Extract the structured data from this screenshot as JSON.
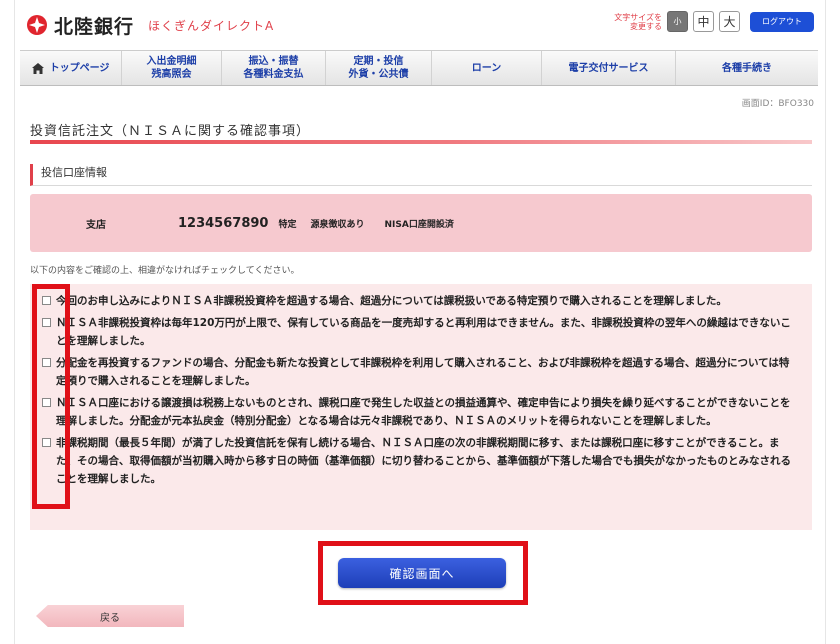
{
  "header": {
    "bank_name": "北陸銀行",
    "service_name": "ほくぎんダイレクトA",
    "fontsize_label": "文字サイズを変更する",
    "fontsize_small": "小",
    "fontsize_medium": "中",
    "fontsize_large": "大",
    "logout_label": "ログアウト"
  },
  "nav": {
    "items": [
      {
        "label": "トップページ"
      },
      {
        "label": "入出金明細\n残高照会"
      },
      {
        "label": "振込・振替\n各種料金支払"
      },
      {
        "label": "定期・投信\n外貨・公共債"
      },
      {
        "label": "ローン"
      },
      {
        "label": "電子交付サービス"
      },
      {
        "label": "各種手続き"
      }
    ]
  },
  "screen_id": "画面ID：BFO330",
  "page_title": "投資信託注文（ＮＩＳＡに関する確認事項）",
  "section_header": "投信口座情報",
  "account": {
    "branch": "支店",
    "number": "1234567890",
    "type": "特定",
    "tax": "源泉徴収あり",
    "nisa": "NISA口座開設済"
  },
  "instruction": "以下の内容をご確認の上、相違がなければチェックしてください。",
  "confirm_items": [
    {
      "text": "今回のお申し込みによりＮＩＳＡ非課税投資枠を超過する場合、超過分については課税扱いである特定預りで購入されることを理解しました。"
    },
    {
      "text": "ＮＩＳＡ非課税投資枠は毎年120万円が上限で、保有している商品を一度売却すると再利用はできません。また、非課税投資枠の翌年への繰越はできないことを理解しました。"
    },
    {
      "text": "分配金を再投資するファンドの場合、分配金も新たな投資として非課税枠を利用して購入されること、および非課税枠を超過する場合、超過分については特定預りで購入されることを理解しました。"
    },
    {
      "text": "ＮＩＳＡ口座における譲渡損は税務上ないものとされ、課税口座で発生した収益との損益通算や、確定申告により損失を繰り延べすることができないことを理解しました。分配金が元本払戻金（特別分配金）となる場合は元々非課税であり、ＮＩＳＡのメリットを得られないことを理解しました。"
    },
    {
      "text": "非課税期間（最長５年間）が満了した投資信託を保有し続ける場合、ＮＩＳＡ口座の次の非課税期間に移す、または課税口座に移すことができること。また、その場合、取得価額が当初購入時から移す日の時価（基準価額）に切り替わることから、基準価額が下落した場合でも損失がなかったものとみなされることを理解しました。"
    }
  ],
  "submit_label": "確認画面へ",
  "back_label": "戻る",
  "colors": {
    "brand_red": "#e0404a",
    "nav_blue": "#1d3fa8",
    "button_blue": "#1e3fb8",
    "highlight_red": "#e01018"
  }
}
